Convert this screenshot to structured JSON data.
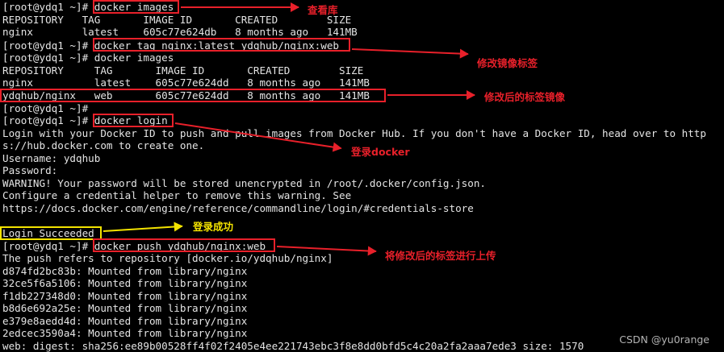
{
  "terminal": {
    "lines": [
      "[root@ydq1 ~]# docker images",
      "REPOSITORY   TAG       IMAGE ID       CREATED        SIZE",
      "nginx        latest    605c77e624db   8 months ago   141MB",
      "[root@ydq1 ~]# docker tag nginx:latest ydqhub/nginx:web",
      "[root@ydq1 ~]# docker images",
      "REPOSITORY     TAG       IMAGE ID       CREATED        SIZE",
      "nginx          latest    605c77e624dd   8 months ago   141MB",
      "ydqhub/nginx   web       605c77e624dd   8 months ago   141MB",
      "[root@ydq1 ~]#",
      "[root@ydq1 ~]# docker login",
      "Login with your Docker ID to push and pull images from Docker Hub. If you don't have a Docker ID, head over to http",
      "s://hub.docker.com to create one.",
      "Username: ydqhub",
      "Password:",
      "WARNING! Your password will be stored unencrypted in /root/.docker/config.json.",
      "Configure a credential helper to remove this warning. See",
      "https://docs.docker.com/engine/reference/commandline/login/#credentials-store",
      "",
      "Login Succeeded",
      "[root@ydq1 ~]# docker push ydqhub/nginx:web",
      "The push refers to repository [docker.io/ydqhub/nginx]",
      "d874fd2bc83b: Mounted from library/nginx",
      "32ce5f6a5106: Mounted from library/nginx",
      "f1db227348d0: Mounted from library/nginx",
      "b8d6e692a25e: Mounted from library/nginx",
      "e379e8aedd4d: Mounted from library/nginx",
      "2edcec3590a4: Mounted from library/nginx",
      "web: digest: sha256:ee89b00528ff4f02f2405e4ee221743ebc3f8e8dd0bfd5c4c20a2fa2aaa7ede3 size: 1570"
    ]
  },
  "annotations": {
    "view_repo": "查看库",
    "modify_tag": "修改镜像标签",
    "modified_tag_image": "修改后的标签镜像",
    "login_docker": "登录docker",
    "login_success": "登录成功",
    "push_modified": "将修改后的标签进行上传"
  },
  "colors": {
    "annotation_red": "#e8202a",
    "annotation_yellow": "#f3e300",
    "terminal_bg": "#000000",
    "terminal_fg": "#e4e4e4"
  },
  "watermark": "CSDN @yu0range"
}
